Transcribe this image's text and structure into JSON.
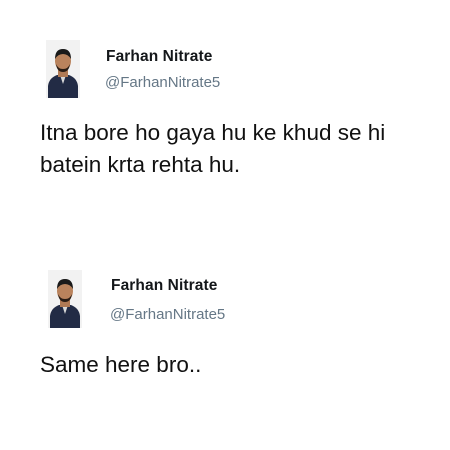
{
  "tweets": [
    {
      "author_name": "Farhan Nitrate",
      "author_handle": "@FarhanNitrate5",
      "text_lines": [
        "Itna bore ho gaya hu ke khud se hi",
        "batein krta rehta hu."
      ]
    },
    {
      "author_name": "Farhan Nitrate",
      "author_handle": "@FarhanNitrate5",
      "text_lines": [
        "Same here bro.."
      ]
    }
  ]
}
